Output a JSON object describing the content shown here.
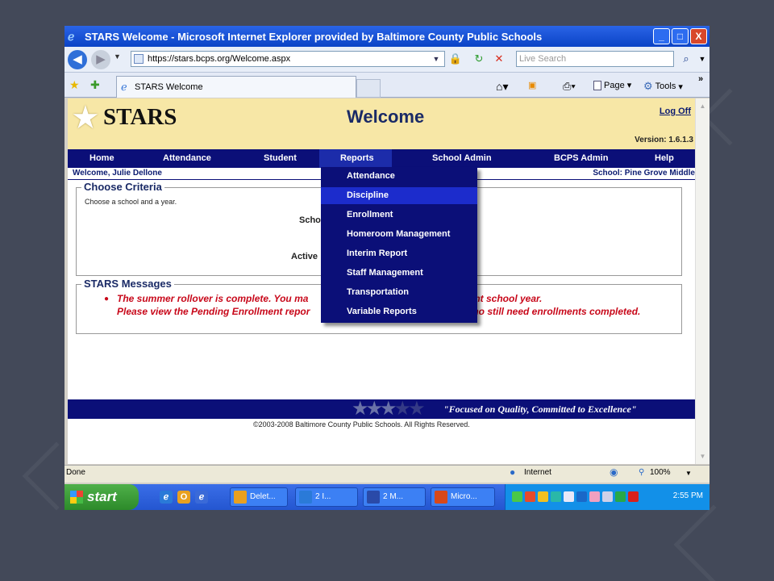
{
  "window": {
    "title": "STARS Welcome - Microsoft Internet Explorer provided by Baltimore County Public Schools",
    "controls": [
      "_",
      "□",
      "X"
    ]
  },
  "addressbar": {
    "url": "https://stars.bcps.org/Welcome.aspx",
    "search_placeholder": "Live Search"
  },
  "tabbar": {
    "tab_title": "STARS Welcome",
    "tools": [
      {
        "label": "Page",
        "icon": "page-icon"
      },
      {
        "label": "Tools",
        "icon": "gear-icon"
      }
    ]
  },
  "page": {
    "logo": "STARS",
    "title": "Welcome",
    "logoff": "Log Off",
    "version": "Version: 1.6.1.3",
    "menu": [
      "Home",
      "Attendance",
      "Student",
      "Reports",
      "School Admin",
      "BCPS Admin",
      "Help"
    ],
    "welcome_user": "Welcome, Julie Dellone",
    "school": "School: Pine Grove Middle",
    "criteria": {
      "legend": "Choose Criteria",
      "help": "Choose a school and a year.",
      "label1": "Scho",
      "label2": "Active"
    },
    "messages": {
      "legend": "STARS Messages",
      "line1_left": "The summer rollover is complete. You ma",
      "line1_right": "rent school year.",
      "line2_left": "Please view the Pending Enrollment repor",
      "line2_right": "who still need enrollments completed."
    },
    "slogan": "\"Focused on Quality, Committed to Excellence\"",
    "copyright": "©2003-2008 Baltimore County Public Schools. All Rights Reserved."
  },
  "dropdown": {
    "items": [
      "Attendance",
      "Discipline",
      "Enrollment",
      "Homeroom Management",
      "Interim Report",
      "Staff Management",
      "Transportation",
      "Variable Reports"
    ],
    "highlighted": "Discipline"
  },
  "statusbar": {
    "status": "Done",
    "zone": "Internet",
    "zoom": "100%"
  },
  "taskbar": {
    "start": "start",
    "tasks": [
      "Delet...",
      "2 I...",
      "2 M...",
      "Micro..."
    ],
    "clock": "2:55 PM"
  }
}
